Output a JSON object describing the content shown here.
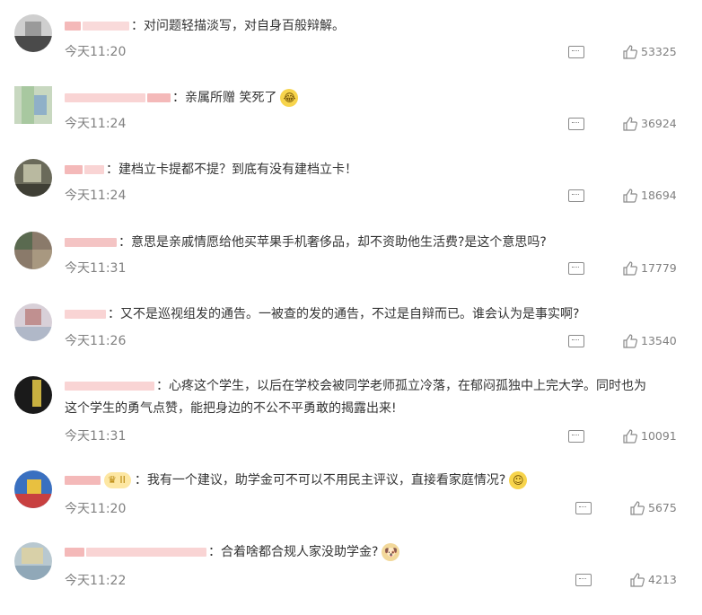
{
  "comments": [
    {
      "text": "对问题轻描淡写，对自身百般辩解。",
      "time": "今天11:20",
      "likes": "53325"
    },
    {
      "text": "亲属所赠 笑死了",
      "time": "今天11:24",
      "likes": "36924",
      "emoji": "laugh-cry-emoji"
    },
    {
      "text": "建档立卡提都不提？到底有没有建档立卡！",
      "time": "今天11:24",
      "likes": "18694"
    },
    {
      "text": "意思是亲戚情愿给他买苹果手机奢侈品，却不资助他生活费?是这个意思吗?",
      "time": "今天11:31",
      "likes": "17779"
    },
    {
      "text": "又不是巡视组发的通告。一被查的发的通告，不过是自辩而已。谁会认为是事实啊?",
      "time": "今天11:26",
      "likes": "13540"
    },
    {
      "text": "心疼这个学生，以后在学校会被同学老师孤立冷落，在郁闷孤独中上完大学。同时也为",
      "text2": "这个学生的勇气点赞，能把身边的不公不平勇敢的揭露出来!",
      "time": "今天11:31",
      "likes": "10091"
    },
    {
      "text": "我有一个建议，助学金可不可以不用民主评议，直接看家庭情况?",
      "time": "今天11:20",
      "likes": "5675",
      "badge": "II",
      "emoji": "smile-emoji"
    },
    {
      "text": "合着啥都合规人家没助学金?",
      "time": "今天11:22",
      "likes": "4213",
      "emoji": "doge-emoji"
    }
  ],
  "colon": "："
}
